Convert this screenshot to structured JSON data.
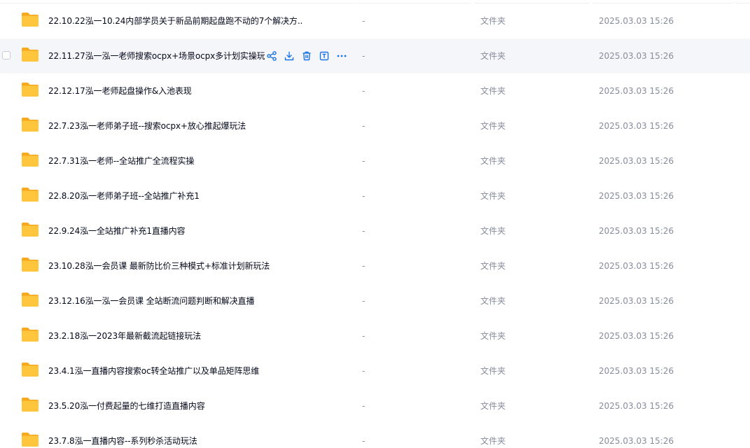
{
  "colors": {
    "folder": "#ffc53d",
    "folder_back": "#f6a91f",
    "action": "#1a73e8",
    "secondary_text": "#878c9c",
    "hover_row": "#f5f6fa"
  },
  "actions": [
    {
      "name": "share-icon"
    },
    {
      "name": "download-icon"
    },
    {
      "name": "delete-icon"
    },
    {
      "name": "rename-icon"
    },
    {
      "name": "more-icon"
    }
  ],
  "files": [
    {
      "name": "22.10.22泓一10.24内部学员关于新品前期起盘跑不动的7个解决方...",
      "size": "-",
      "type": "文件夹",
      "modified": "2025.03.03 15:26",
      "hovered": false
    },
    {
      "name": "22.11.27泓一泓一老师搜索ocpx+场景ocpx多计划实操玩法",
      "size": "-",
      "type": "文件夹",
      "modified": "2025.03.03 15:26",
      "hovered": true
    },
    {
      "name": "22.12.17泓一老师起盘操作&入池表现",
      "size": "-",
      "type": "文件夹",
      "modified": "2025.03.03 15:26",
      "hovered": false
    },
    {
      "name": "22.7.23泓一老师弟子班--搜索ocpx+放心推起爆玩法",
      "size": "-",
      "type": "文件夹",
      "modified": "2025.03.03 15:26",
      "hovered": false
    },
    {
      "name": "22.7.31泓一老师--全站推广全流程实操",
      "size": "-",
      "type": "文件夹",
      "modified": "2025.03.03 15:26",
      "hovered": false
    },
    {
      "name": "22.8.20泓一老师弟子班--全站推广补充1",
      "size": "-",
      "type": "文件夹",
      "modified": "2025.03.03 15:26",
      "hovered": false
    },
    {
      "name": "22.9.24泓一全站推广补充1直播内容",
      "size": "-",
      "type": "文件夹",
      "modified": "2025.03.03 15:26",
      "hovered": false
    },
    {
      "name": "23.10.28泓一会员课 最新防比价三种模式+标准计划新玩法",
      "size": "-",
      "type": "文件夹",
      "modified": "2025.03.03 15:26",
      "hovered": false
    },
    {
      "name": "23.12.16泓一泓一会员课 全站断流问题判断和解决直播",
      "size": "-",
      "type": "文件夹",
      "modified": "2025.03.03 15:26",
      "hovered": false
    },
    {
      "name": "23.2.18泓一2023年最新截流起链接玩法",
      "size": "-",
      "type": "文件夹",
      "modified": "2025.03.03 15:26",
      "hovered": false
    },
    {
      "name": "23.4.1泓一直播内容搜索oc转全站推广以及单品矩阵思维",
      "size": "-",
      "type": "文件夹",
      "modified": "2025.03.03 15:26",
      "hovered": false
    },
    {
      "name": "23.5.20泓一付费起量的七维打造直播内容",
      "size": "-",
      "type": "文件夹",
      "modified": "2025.03.03 15:26",
      "hovered": false
    },
    {
      "name": "23.7.8泓一直播内容--系列秒杀活动玩法",
      "size": "-",
      "type": "文件夹",
      "modified": "2025.03.03 15:26",
      "hovered": false
    }
  ]
}
